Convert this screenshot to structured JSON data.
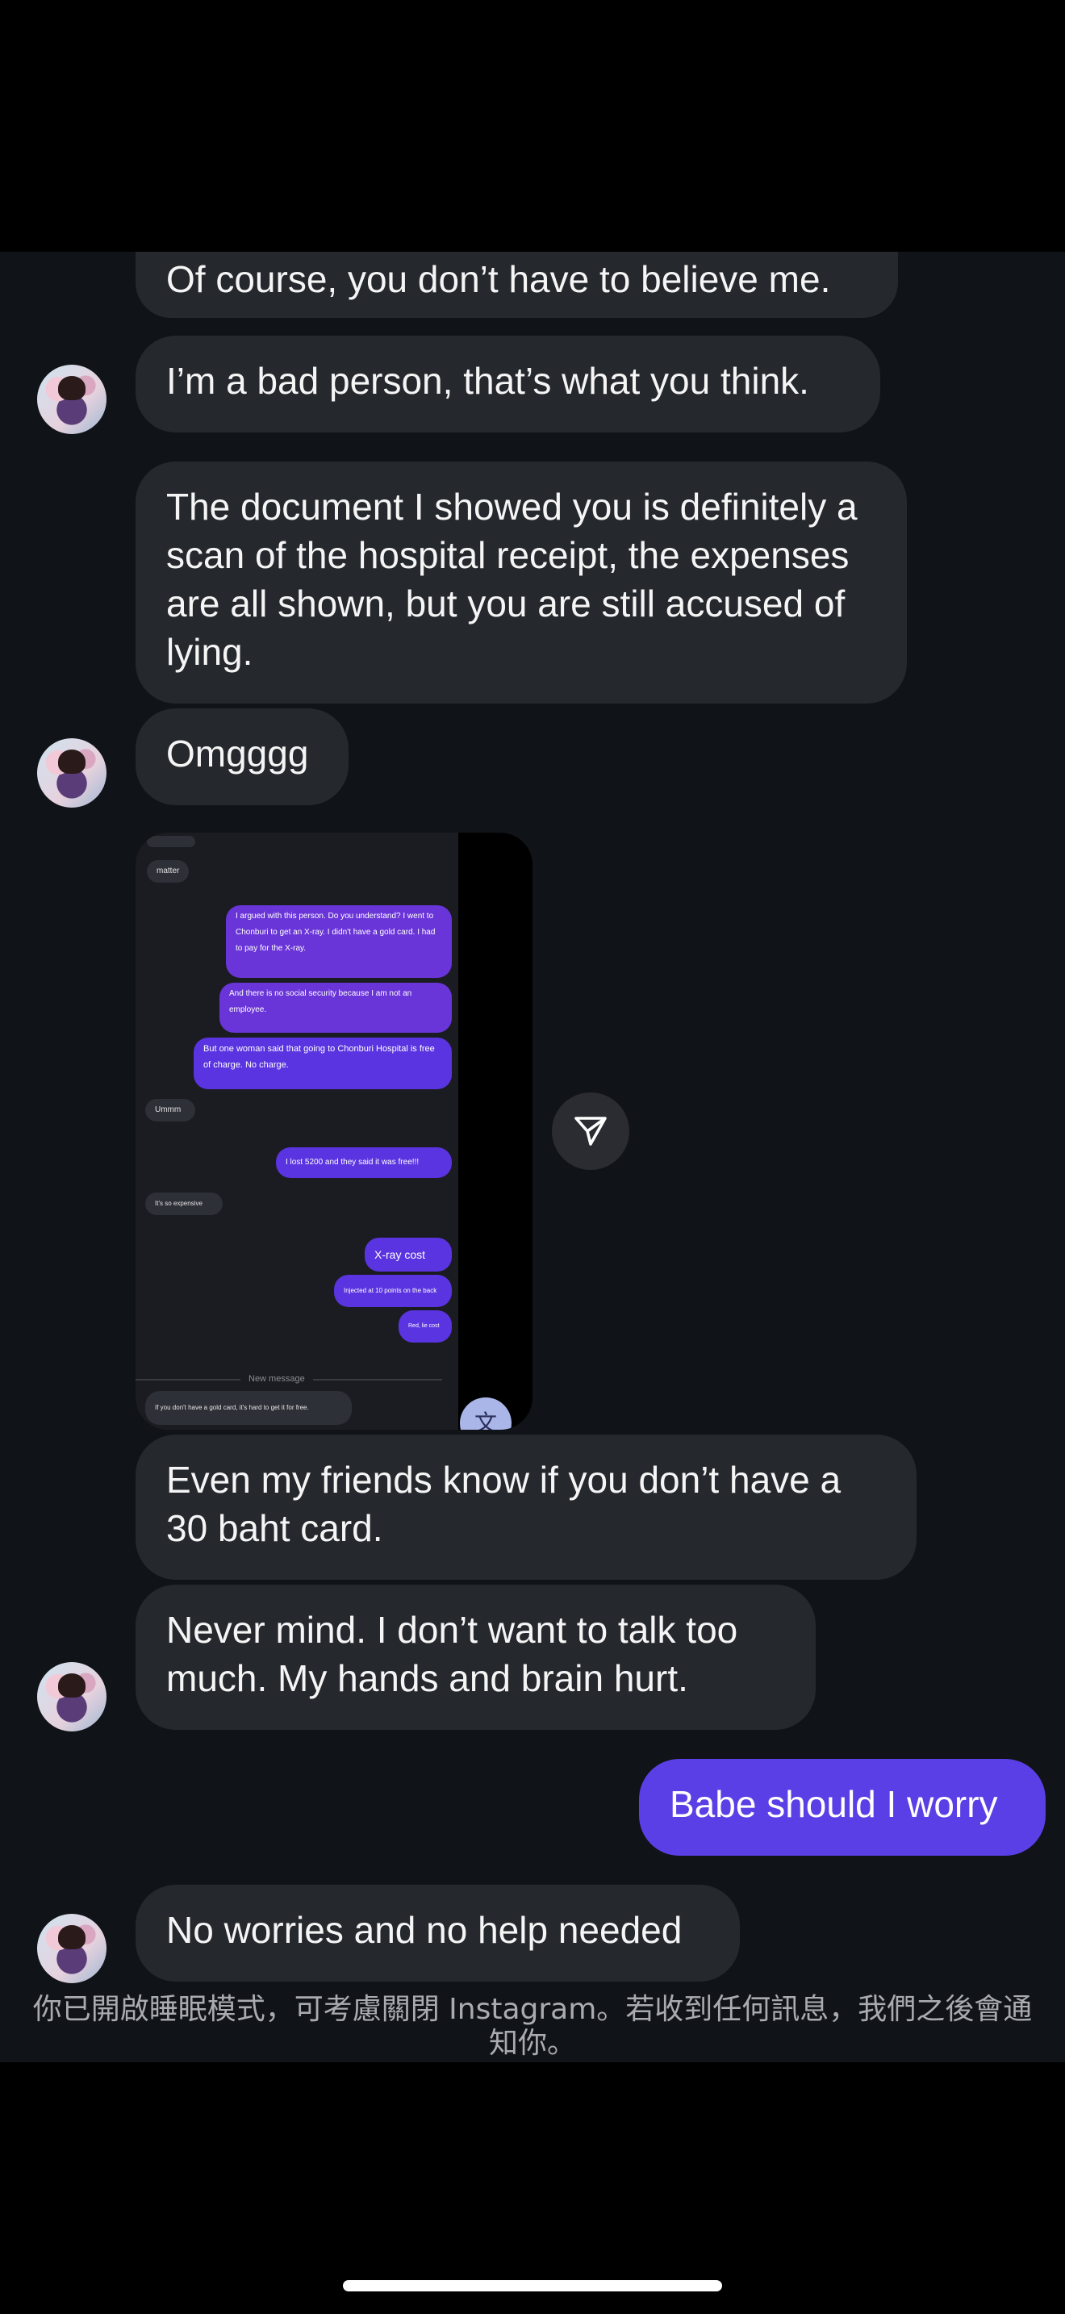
{
  "messages": {
    "m1": "Of course, you don’t have to believe me.",
    "m2": "I’m a bad person, that’s what you think.",
    "m3": "The document I showed you is definitely a scan of the hospital receipt, the expenses are all shown, but you are still accused of lying.",
    "m4": "Omgggg",
    "m5": "Even my friends know if you don’t have a 30 baht card.",
    "m6": "Never mind. I don’t want to talk too much. My hands and brain hurt.",
    "m7": "Babe should I worry",
    "m8": "No worries and no help needed"
  },
  "shared_media": {
    "items": {
      "matter": "matter",
      "argued": "I argued with this person. Do you understand? I went to Chonburi to get an X-ray. I didn't have a gold card. I had to pay for the X-ray.",
      "no_social": "And there is no social security because I am not an employee.",
      "one_woman": "But one woman said that going to Chonburi Hospital is free of charge. No charge.",
      "ummm": "Ummm",
      "lost": "I lost 5200 and they said it was free!!!",
      "expensive": "It's so expensive",
      "xray_cost": "X-ray cost",
      "injected": "Injected at 10 points on the back",
      "red_note": "Red, lie cost",
      "new_message": "New message",
      "gold_card": "If you don't have a gold card, it's hard to get it for free."
    },
    "translate_icon_glyph": "文"
  },
  "notice": "你已開啟睡眠模式，可考慮關閉 Instagram。若收到任何訊息，我們之後會通知你。",
  "colors": {
    "chat_bg": "#101317",
    "incoming_bubble": "#25282d",
    "outgoing_bubble": "#5b3fe6"
  }
}
